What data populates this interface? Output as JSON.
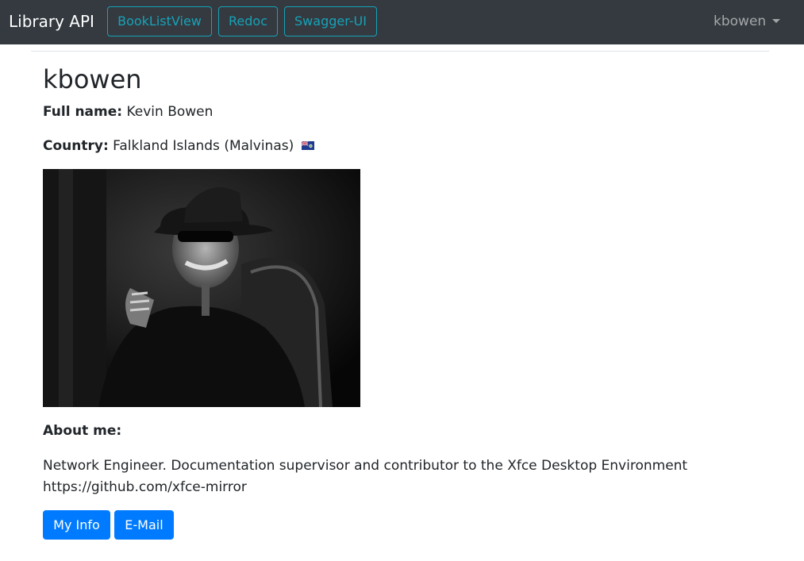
{
  "navbar": {
    "brand": "Library API",
    "links": [
      "BookListView",
      "Redoc",
      "Swagger-UI"
    ],
    "user_menu": "kbowen"
  },
  "profile": {
    "username": "kbowen",
    "full_name_label": "Full name:",
    "full_name": "Kevin Bowen",
    "country_label": "Country:",
    "country": "Falkland Islands (Malvinas)",
    "about_label": "About me:",
    "about_text": "Network Engineer. Documentation supervisor and contributor to the Xfce Desktop Environment https://github.com/xfce-mirror"
  },
  "actions": {
    "my_info": "My Info",
    "email": "E-Mail"
  },
  "colors": {
    "navbar_bg": "#343a40",
    "outline_info": "#17a2b8",
    "primary": "#007bff"
  }
}
